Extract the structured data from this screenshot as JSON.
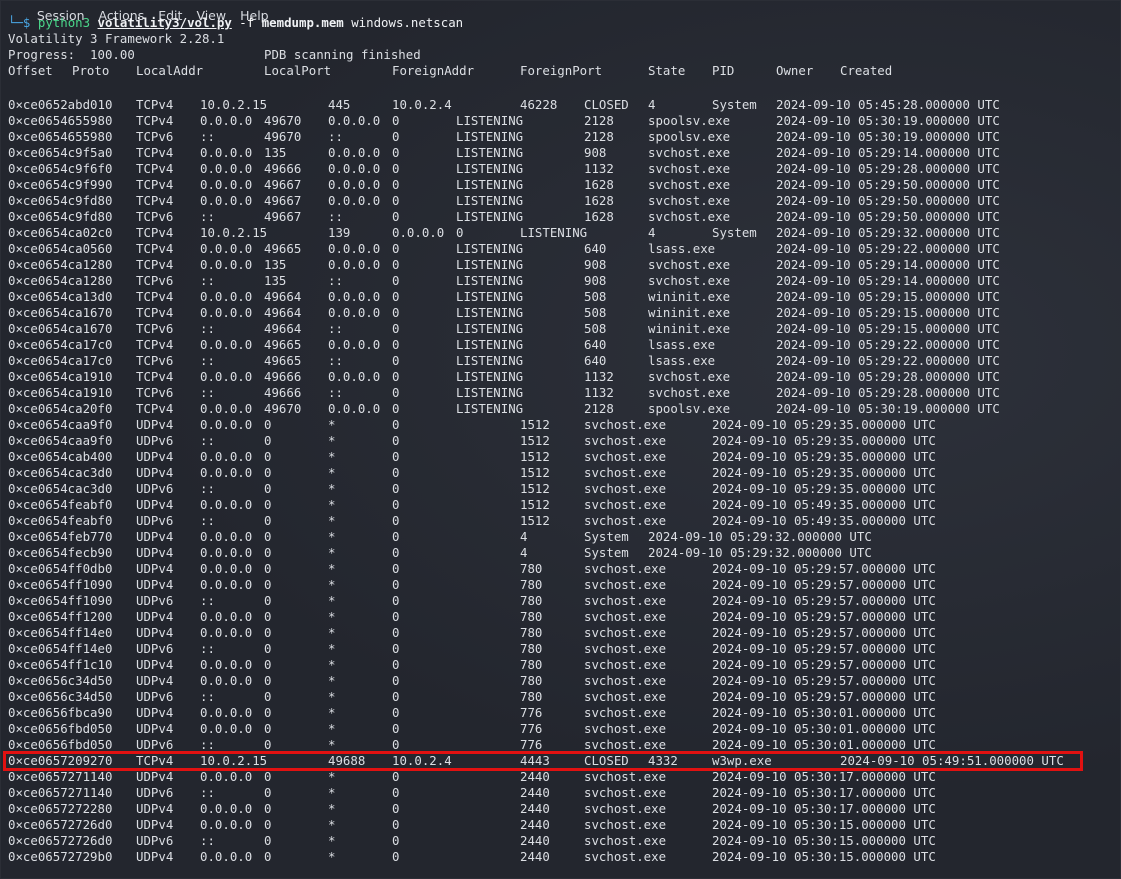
{
  "menu": [
    "Session",
    "Actions",
    "Edit",
    "View",
    "Help"
  ],
  "command": {
    "prompt_glyph": "└─$",
    "bin": "python3",
    "script": "volatility3/vol.py",
    "flag": "-f",
    "file": "memdump.mem",
    "plugin": "windows.netscan"
  },
  "banner": "Volatility 3 Framework 2.28.1",
  "progress": "Progress:  100.00\t\tPDB scanning finished",
  "headers": [
    "Offset",
    "Proto",
    "LocalAddr",
    "LocalPort",
    "ForeignAddr",
    "ForeignPort",
    "State",
    "PID",
    "Owner",
    "Created"
  ],
  "rows": [
    "0×ce0652abd010\tTCPv4\t10.0.2.15\t445\t10.0.2.4\t46228\tCLOSED\t4\tSystem\t2024-09-10 05:45:28.000000 UTC",
    "0×ce0654655980\tTCPv4\t0.0.0.0\t49670\t0.0.0.0\t0\tLISTENING\t2128\tspoolsv.exe\t2024-09-10 05:30:19.000000 UTC",
    "0×ce0654655980\tTCPv6\t::\t49670\t::\t0\tLISTENING\t2128\tspoolsv.exe\t2024-09-10 05:30:19.000000 UTC",
    "0×ce0654c9f5a0\tTCPv4\t0.0.0.0\t135\t0.0.0.0\t0\tLISTENING\t908\tsvchost.exe\t2024-09-10 05:29:14.000000 UTC",
    "0×ce0654c9f6f0\tTCPv4\t0.0.0.0\t49666\t0.0.0.0\t0\tLISTENING\t1132\tsvchost.exe\t2024-09-10 05:29:28.000000 UTC",
    "0×ce0654c9f990\tTCPv4\t0.0.0.0\t49667\t0.0.0.0\t0\tLISTENING\t1628\tsvchost.exe\t2024-09-10 05:29:50.000000 UTC",
    "0×ce0654c9fd80\tTCPv4\t0.0.0.0\t49667\t0.0.0.0\t0\tLISTENING\t1628\tsvchost.exe\t2024-09-10 05:29:50.000000 UTC",
    "0×ce0654c9fd80\tTCPv6\t::\t49667\t::\t0\tLISTENING\t1628\tsvchost.exe\t2024-09-10 05:29:50.000000 UTC",
    "0×ce0654ca02c0\tTCPv4\t10.0.2.15\t139\t0.0.0.0\t0\tLISTENING\t4\tSystem\t2024-09-10 05:29:32.000000 UTC",
    "0×ce0654ca0560\tTCPv4\t0.0.0.0\t49665\t0.0.0.0\t0\tLISTENING\t640\tlsass.exe\t2024-09-10 05:29:22.000000 UTC",
    "0×ce0654ca1280\tTCPv4\t0.0.0.0\t135\t0.0.0.0\t0\tLISTENING\t908\tsvchost.exe\t2024-09-10 05:29:14.000000 UTC",
    "0×ce0654ca1280\tTCPv6\t::\t135\t::\t0\tLISTENING\t908\tsvchost.exe\t2024-09-10 05:29:14.000000 UTC",
    "0×ce0654ca13d0\tTCPv4\t0.0.0.0\t49664\t0.0.0.0\t0\tLISTENING\t508\twininit.exe\t2024-09-10 05:29:15.000000 UTC",
    "0×ce0654ca1670\tTCPv4\t0.0.0.0\t49664\t0.0.0.0\t0\tLISTENING\t508\twininit.exe\t2024-09-10 05:29:15.000000 UTC",
    "0×ce0654ca1670\tTCPv6\t::\t49664\t::\t0\tLISTENING\t508\twininit.exe\t2024-09-10 05:29:15.000000 UTC",
    "0×ce0654ca17c0\tTCPv4\t0.0.0.0\t49665\t0.0.0.0\t0\tLISTENING\t640\tlsass.exe\t2024-09-10 05:29:22.000000 UTC",
    "0×ce0654ca17c0\tTCPv6\t::\t49665\t::\t0\tLISTENING\t640\tlsass.exe\t2024-09-10 05:29:22.000000 UTC",
    "0×ce0654ca1910\tTCPv4\t0.0.0.0\t49666\t0.0.0.0\t0\tLISTENING\t1132\tsvchost.exe\t2024-09-10 05:29:28.000000 UTC",
    "0×ce0654ca1910\tTCPv6\t::\t49666\t::\t0\tLISTENING\t1132\tsvchost.exe\t2024-09-10 05:29:28.000000 UTC",
    "0×ce0654ca20f0\tTCPv4\t0.0.0.0\t49670\t0.0.0.0\t0\tLISTENING\t2128\tspoolsv.exe\t2024-09-10 05:30:19.000000 UTC",
    "0×ce0654caa9f0\tUDPv4\t0.0.0.0\t0\t*\t0\t\t1512\tsvchost.exe\t2024-09-10 05:29:35.000000 UTC",
    "0×ce0654caa9f0\tUDPv6\t::\t0\t*\t0\t\t1512\tsvchost.exe\t2024-09-10 05:29:35.000000 UTC",
    "0×ce0654cab400\tUDPv4\t0.0.0.0\t0\t*\t0\t\t1512\tsvchost.exe\t2024-09-10 05:29:35.000000 UTC",
    "0×ce0654cac3d0\tUDPv4\t0.0.0.0\t0\t*\t0\t\t1512\tsvchost.exe\t2024-09-10 05:29:35.000000 UTC",
    "0×ce0654cac3d0\tUDPv6\t::\t0\t*\t0\t\t1512\tsvchost.exe\t2024-09-10 05:29:35.000000 UTC",
    "0×ce0654feabf0\tUDPv4\t0.0.0.0\t0\t*\t0\t\t1512\tsvchost.exe\t2024-09-10 05:49:35.000000 UTC",
    "0×ce0654feabf0\tUDPv6\t::\t0\t*\t0\t\t1512\tsvchost.exe\t2024-09-10 05:49:35.000000 UTC",
    "0×ce0654feb770\tUDPv4\t0.0.0.0\t0\t*\t0\t\t4\tSystem\t2024-09-10 05:29:32.000000 UTC",
    "0×ce0654fecb90\tUDPv4\t0.0.0.0\t0\t*\t0\t\t4\tSystem\t2024-09-10 05:29:32.000000 UTC",
    "0×ce0654ff0db0\tUDPv4\t0.0.0.0\t0\t*\t0\t\t780\tsvchost.exe\t2024-09-10 05:29:57.000000 UTC",
    "0×ce0654ff1090\tUDPv4\t0.0.0.0\t0\t*\t0\t\t780\tsvchost.exe\t2024-09-10 05:29:57.000000 UTC",
    "0×ce0654ff1090\tUDPv6\t::\t0\t*\t0\t\t780\tsvchost.exe\t2024-09-10 05:29:57.000000 UTC",
    "0×ce0654ff1200\tUDPv4\t0.0.0.0\t0\t*\t0\t\t780\tsvchost.exe\t2024-09-10 05:29:57.000000 UTC",
    "0×ce0654ff14e0\tUDPv4\t0.0.0.0\t0\t*\t0\t\t780\tsvchost.exe\t2024-09-10 05:29:57.000000 UTC",
    "0×ce0654ff14e0\tUDPv6\t::\t0\t*\t0\t\t780\tsvchost.exe\t2024-09-10 05:29:57.000000 UTC",
    "0×ce0654ff1c10\tUDPv4\t0.0.0.0\t0\t*\t0\t\t780\tsvchost.exe\t2024-09-10 05:29:57.000000 UTC",
    "0×ce0656c34d50\tUDPv4\t0.0.0.0\t0\t*\t0\t\t780\tsvchost.exe\t2024-09-10 05:29:57.000000 UTC",
    "0×ce0656c34d50\tUDPv6\t::\t0\t*\t0\t\t780\tsvchost.exe\t2024-09-10 05:29:57.000000 UTC",
    "0×ce0656fbca90\tUDPv4\t0.0.0.0\t0\t*\t0\t\t776\tsvchost.exe\t2024-09-10 05:30:01.000000 UTC",
    "0×ce0656fbd050\tUDPv4\t0.0.0.0\t0\t*\t0\t\t776\tsvchost.exe\t2024-09-10 05:30:01.000000 UTC",
    "0×ce0656fbd050\tUDPv6\t::\t0\t*\t0\t\t776\tsvchost.exe\t2024-09-10 05:30:01.000000 UTC",
    "0×ce0657209270\tTCPv4\t10.0.2.15\t49688\t10.0.2.4\t4443\tCLOSED\t4332\tw3wp.exe\t2024-09-10 05:49:51.000000 UTC",
    "0×ce0657271140\tUDPv4\t0.0.0.0\t0\t*\t0\t\t2440\tsvchost.exe\t2024-09-10 05:30:17.000000 UTC",
    "0×ce0657271140\tUDPv6\t::\t0\t*\t0\t\t2440\tsvchost.exe\t2024-09-10 05:30:17.000000 UTC",
    "0×ce0657272280\tUDPv4\t0.0.0.0\t0\t*\t0\t\t2440\tsvchost.exe\t2024-09-10 05:30:17.000000 UTC",
    "0×ce06572726d0\tUDPv4\t0.0.0.0\t0\t*\t0\t\t2440\tsvchost.exe\t2024-09-10 05:30:15.000000 UTC",
    "0×ce06572726d0\tUDPv6\t::\t0\t*\t0\t\t2440\tsvchost.exe\t2024-09-10 05:30:15.000000 UTC",
    "0×ce06572729b0\tUDPv4\t0.0.0.0\t0\t*\t0\t\t2440\tsvchost.exe\t2024-09-10 05:30:15.000000 UTC"
  ],
  "highlight_row": 41,
  "highlight_color": "#e11111"
}
